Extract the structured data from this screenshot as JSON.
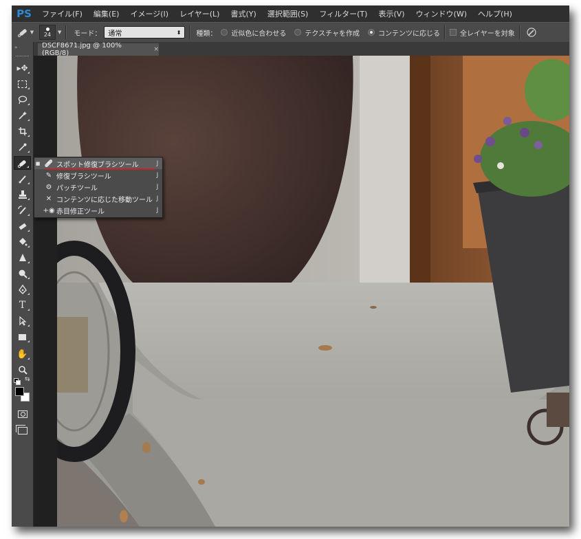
{
  "app": {
    "logo": "PS"
  },
  "menubar": {
    "items": [
      "ファイル(F)",
      "編集(E)",
      "イメージ(I)",
      "レイヤー(L)",
      "書式(Y)",
      "選択範囲(S)",
      "フィルター(T)",
      "表示(V)",
      "ウィンドウ(W)",
      "ヘルプ(H)"
    ]
  },
  "options": {
    "brush_size": "24",
    "mode_label": "モード：",
    "mode_value": "通常",
    "type_label": "種類：",
    "radio_proximity": "近似色に合わせる",
    "radio_texture": "テクスチャを作成",
    "radio_content_aware": "コンテンツに応じる",
    "selected_radio": "radio_content_aware",
    "sample_all_layers": "全レイヤーを対象",
    "sample_all_layers_checked": false
  },
  "document": {
    "tab_title": "DSCF8671.jpg @ 100% (RGB/8)",
    "close_glyph": "×"
  },
  "flyout": {
    "items": [
      {
        "label": "スポット修復ブラシツール",
        "shortcut": "J",
        "selected": true,
        "icon": "spot-healing-brush-icon"
      },
      {
        "label": "修復ブラシツール",
        "shortcut": "J",
        "selected": false,
        "icon": "healing-brush-icon"
      },
      {
        "label": "パッチツール",
        "shortcut": "J",
        "selected": false,
        "icon": "patch-icon"
      },
      {
        "label": "コンテンツに応じた移動ツール",
        "shortcut": "J",
        "selected": false,
        "icon": "content-aware-move-icon"
      },
      {
        "label": "赤目修正ツール",
        "shortcut": "J",
        "selected": false,
        "icon": "red-eye-icon"
      }
    ],
    "highlight_color": "#c0262a"
  },
  "toolbar": {
    "tools": [
      "move-icon",
      "marquee-icon",
      "lasso-icon",
      "quick-selection-icon",
      "crop-icon",
      "eyedropper-icon",
      "spot-healing-brush-icon",
      "brush-icon",
      "clone-stamp-icon",
      "history-brush-icon",
      "eraser-icon",
      "paint-bucket-icon",
      "blur-icon",
      "dodge-icon",
      "pen-icon",
      "type-icon",
      "path-selection-icon",
      "rectangle-icon",
      "hand-icon",
      "zoom-icon"
    ],
    "active_tool": "spot-healing-brush-icon",
    "text_tool_glyph": "T",
    "foreground_color": "#000000",
    "background_color": "#ffffff"
  },
  "theme": {
    "accent": "#2c8ad6",
    "panel": "#4a4a4a",
    "menubar": "#2f2f2f"
  }
}
